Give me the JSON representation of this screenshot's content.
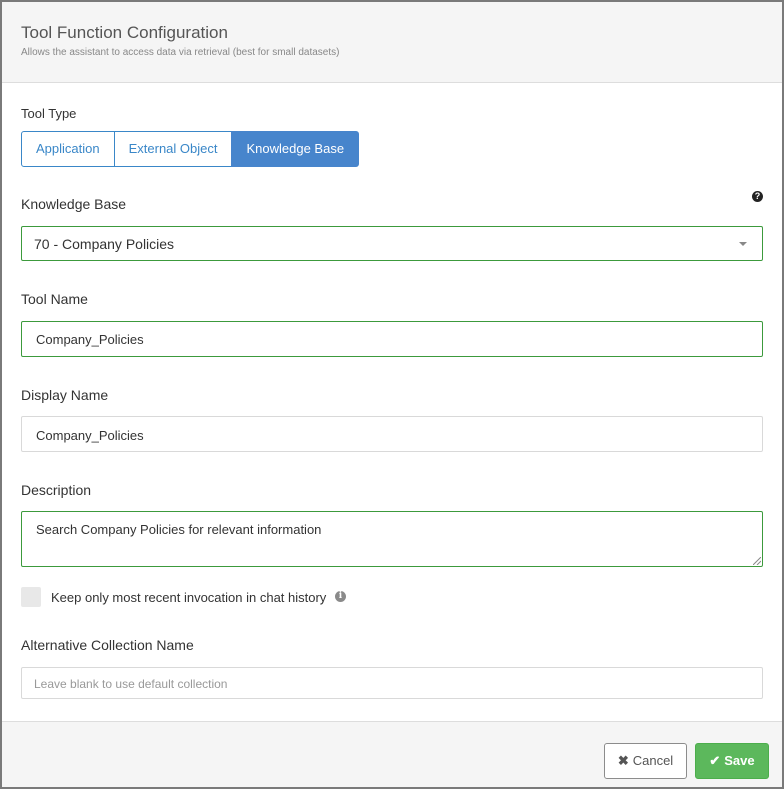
{
  "dialog": {
    "title": "Tool Function Configuration",
    "subtitle": "Allows the assistant to access data via retrieval (best for small datasets)"
  },
  "tool_type": {
    "label": "Tool Type",
    "options": [
      "Application",
      "External Object",
      "Knowledge Base"
    ],
    "selected": "Knowledge Base"
  },
  "knowledge_base": {
    "label": "Knowledge Base",
    "help_icon": "?",
    "value": "70 - Company Policies"
  },
  "tool_name": {
    "label": "Tool Name",
    "value": "Company_Policies"
  },
  "display_name": {
    "label": "Display Name",
    "value": "Company_Policies"
  },
  "description": {
    "label": "Description",
    "value": "Search Company Policies for relevant information"
  },
  "keep_recent": {
    "label": "Keep only most recent invocation in chat history",
    "checked": false,
    "info_icon": "i"
  },
  "alt_collection": {
    "label": "Alternative Collection Name",
    "placeholder": "Leave blank to use default collection"
  },
  "footer": {
    "cancel_icon": "✖",
    "cancel_label": "Cancel",
    "save_icon": "✔",
    "save_label": "Save"
  },
  "colors": {
    "accent": "#4785cc",
    "valid_border": "#3c9a3c",
    "save_green": "#5cb85c"
  }
}
